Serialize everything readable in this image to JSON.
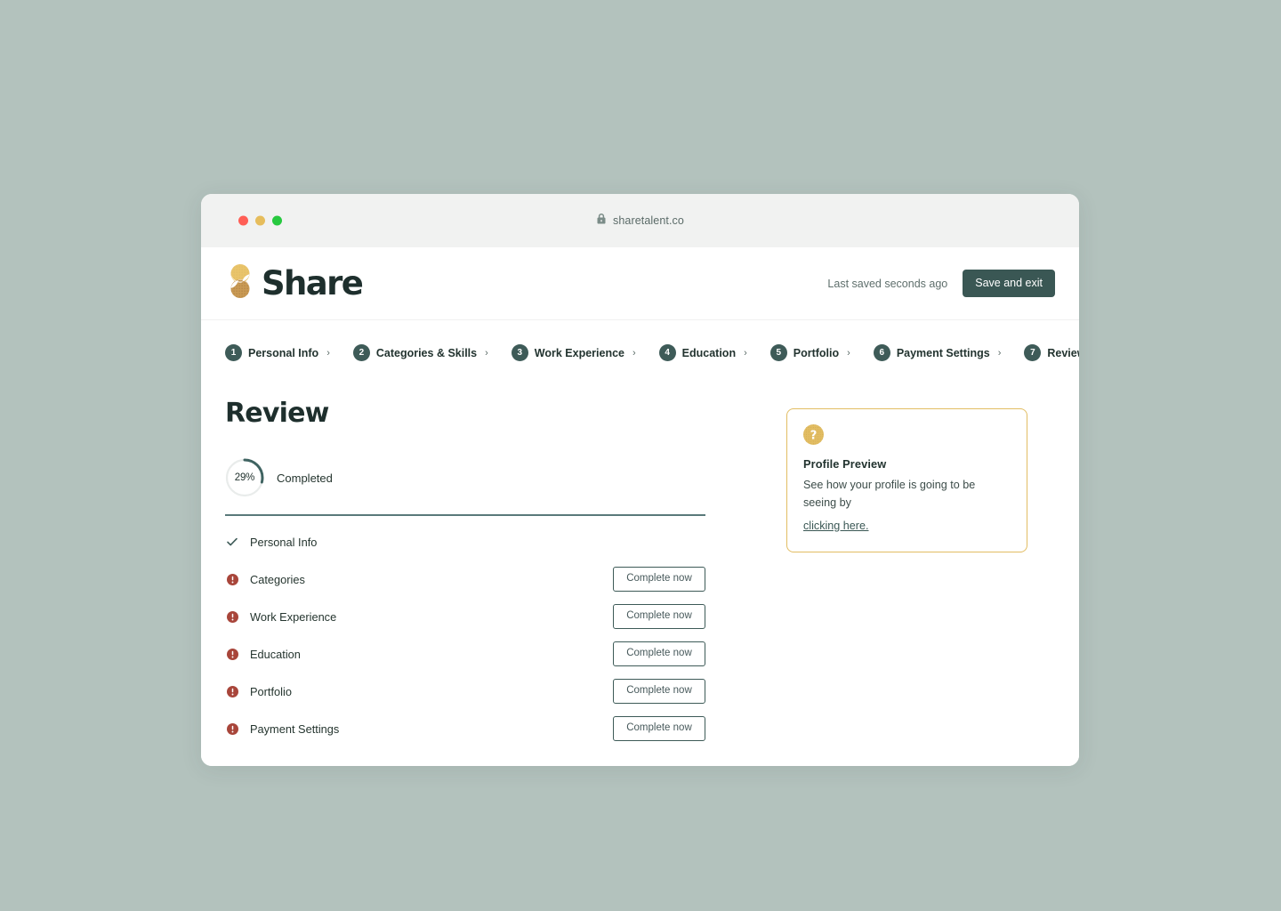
{
  "browser": {
    "url": "sharetalent.co",
    "lock_icon": "lock-icon",
    "traffic_lights": [
      "close-red",
      "minimize-yellow",
      "maximize-green"
    ]
  },
  "header": {
    "logo_text": "Share",
    "logo_icon": "share-s-logo-icon",
    "last_saved": "Last saved seconds ago",
    "save_exit_label": "Save and exit"
  },
  "stepper": {
    "caret": "›",
    "steps": [
      {
        "num": "1",
        "label": "Personal Info",
        "has_caret": true
      },
      {
        "num": "2",
        "label": "Categories & Skills",
        "has_caret": true
      },
      {
        "num": "3",
        "label": "Work Experience",
        "has_caret": true
      },
      {
        "num": "4",
        "label": "Education",
        "has_caret": true
      },
      {
        "num": "5",
        "label": "Portfolio",
        "has_caret": true
      },
      {
        "num": "6",
        "label": "Payment Settings",
        "has_caret": true
      },
      {
        "num": "7",
        "label": "Review",
        "has_caret": false
      }
    ]
  },
  "main": {
    "title": "Review",
    "progress": {
      "percent_label": "29%",
      "percent_value": 29,
      "completed_label": "Completed"
    },
    "checklist": [
      {
        "label": "Personal Info",
        "status": "done",
        "icon": "check-icon",
        "action": null
      },
      {
        "label": "Categories",
        "status": "incomplete",
        "icon": "alert-icon",
        "action": "Complete now"
      },
      {
        "label": "Work Experience",
        "status": "incomplete",
        "icon": "alert-icon",
        "action": "Complete now"
      },
      {
        "label": "Education",
        "status": "incomplete",
        "icon": "alert-icon",
        "action": "Complete now"
      },
      {
        "label": "Portfolio",
        "status": "incomplete",
        "icon": "alert-icon",
        "action": "Complete now"
      },
      {
        "label": "Payment Settings",
        "status": "incomplete",
        "icon": "alert-icon",
        "action": "Complete now"
      }
    ]
  },
  "preview_card": {
    "icon": "question-mark-icon",
    "title": "Profile Preview",
    "body": "See how your profile is going to be seeing by",
    "link": "clicking here."
  },
  "colors": {
    "page_background": "#b3c2bd",
    "accent_teal": "#3e5b58",
    "accent_gold": "#e2bd63",
    "alert_red": "#a8453a",
    "text_dark": "#1e2f2d"
  }
}
